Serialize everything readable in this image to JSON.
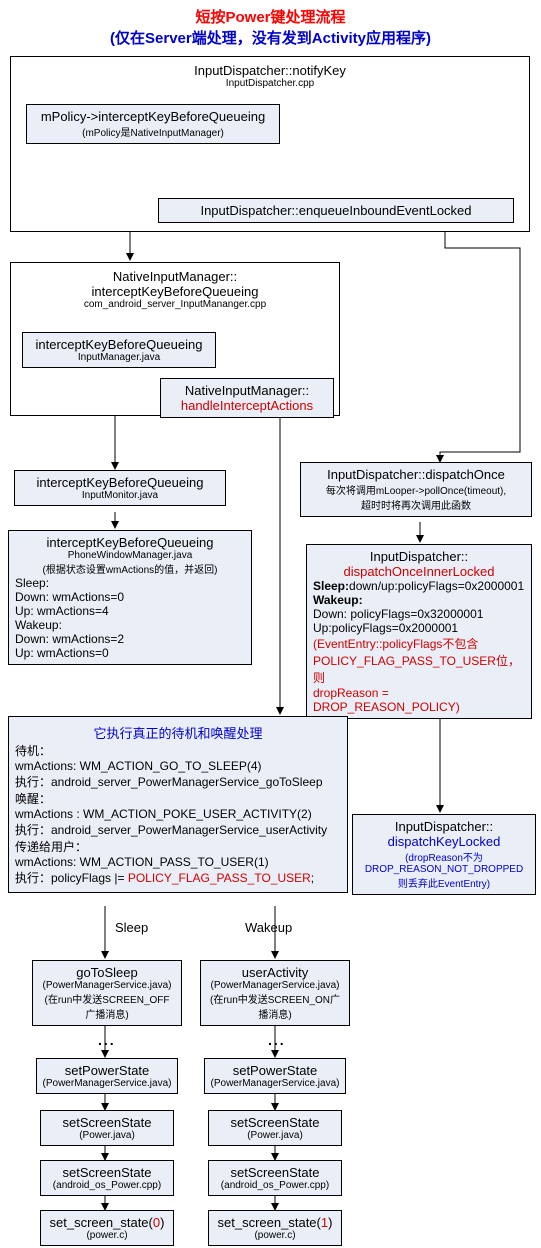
{
  "title": {
    "line1_a": "短按",
    "line1_b": "Power",
    "line1_c": "键处理流程",
    "line2_a": "(仅在",
    "line2_b": "Server",
    "line2_c": "端处理，没有发到",
    "line2_d": "Activity",
    "line2_e": "应用程序)"
  },
  "box1": {
    "title": "InputDispatcher::notifyKey",
    "sub": "InputDispatcher.cpp"
  },
  "box1a": {
    "title": "mPolicy->interceptKeyBeforeQueueing",
    "sub": "(mPolicy是NativeInputManager)"
  },
  "box1b": {
    "title": "InputDispatcher::enqueueInboundEventLocked"
  },
  "box2": {
    "title1": "NativeInputManager::",
    "title2": "interceptKeyBeforeQueueing",
    "sub": "com_android_server_InputMananger.cpp"
  },
  "box2a": {
    "title": "interceptKeyBeforeQueueing",
    "sub": "InputManager.java"
  },
  "box2b": {
    "title": "NativeInputManager::",
    "red": "handleInterceptActions"
  },
  "box3": {
    "title": "interceptKeyBeforeQueueing",
    "sub": "InputMonitor.java"
  },
  "box4": {
    "title": "interceptKeyBeforeQueueing",
    "sub": "PhoneWindowManager.java",
    "l1": "(根据状态设置wmActions的值，并返回)",
    "l2": "Sleep:",
    "l3": "Down: wmActions=0",
    "l4": "Up:      wmActions=4",
    "l5": "Wakeup:",
    "l6": "Down:  wmActions=2",
    "l7": "Up:      wmActions=0"
  },
  "box5": {
    "title": "InputDispatcher::dispatchOnce",
    "l1": "每次将调用mLooper->pollOnce(timeout),",
    "l2": "超时时将再次调用此函数"
  },
  "box6": {
    "title": "InputDispatcher::",
    "red": "dispatchOnceInnerLocked",
    "l1a": "Sleep:",
    "l1b": "down/up:policyFlags=0x2000001",
    "l2": "Wakeup:",
    "l3": "Down: policyFlags=0x32000001",
    "l4": "Up:policyFlags=0x2000001",
    "l5": "(EventEntry::policyFlags不包含",
    "l6": "POLICY_FLAG_PASS_TO_USER位，则",
    "l7": "dropReason = DROP_REASON_POLICY)"
  },
  "box7": {
    "title": "InputDispatcher::",
    "blue": "dispatchKeyLocked",
    "l1": "(dropReason不为",
    "l2": "DROP_REASON_NOT_DROPPED",
    "l3": "则丢弃此EventEntry)"
  },
  "box8": {
    "title": "它执行真正的待机和唤醒处理",
    "l1": "待机：",
    "l2": "wmActions: WM_ACTION_GO_TO_SLEEP(4)",
    "l3": "执行：android_server_PowerManagerService_goToSleep",
    "l4": "唤醒：",
    "l5": "wmActions : WM_ACTION_POKE_USER_ACTIVITY(2)",
    "l6": "执行：android_server_PowerManagerService_userActivity",
    "l7": "传递给用户：",
    "l8": "wmActions: WM_ACTION_PASS_TO_USER(1)",
    "l9a": "执行：policyFlags |= ",
    "l9b": "POLICY_FLAG_PASS_TO_USER",
    "l9c": ";"
  },
  "labels": {
    "sleep": "Sleep",
    "wakeup": "Wakeup"
  },
  "sleep_col": {
    "b1t": "goToSleep",
    "b1s1": "(PowerManagerService.java)",
    "b1s2": "(在run中发送SCREEN_OFF",
    "b1s3": "广播消息)",
    "b2t": "setPowerState",
    "b2s": "(PowerManagerService.java)",
    "b3t": "setScreenState",
    "b3s": "(Power.java)",
    "b4t": "setScreenState",
    "b4s": "(android_os_Power.cpp)",
    "b5a": "set_screen_state(",
    "b5b": "0",
    "b5c": ")",
    "b5s": "(power.c)"
  },
  "wakeup_col": {
    "b1t": "userActivity",
    "b1s1": "(PowerManagerService.java)",
    "b1s2": "(在run中发送SCREEN_ON广",
    "b1s3": "播消息)",
    "b2t": "setPowerState",
    "b2s": "(PowerManagerService.java)",
    "b3t": "setScreenState",
    "b3s": "(Power.java)",
    "b4t": "setScreenState",
    "b4s": "(android_os_Power.cpp)",
    "b5a": "set_screen_state(",
    "b5b": "1",
    "b5c": ")",
    "b5s": "(power.c)"
  }
}
